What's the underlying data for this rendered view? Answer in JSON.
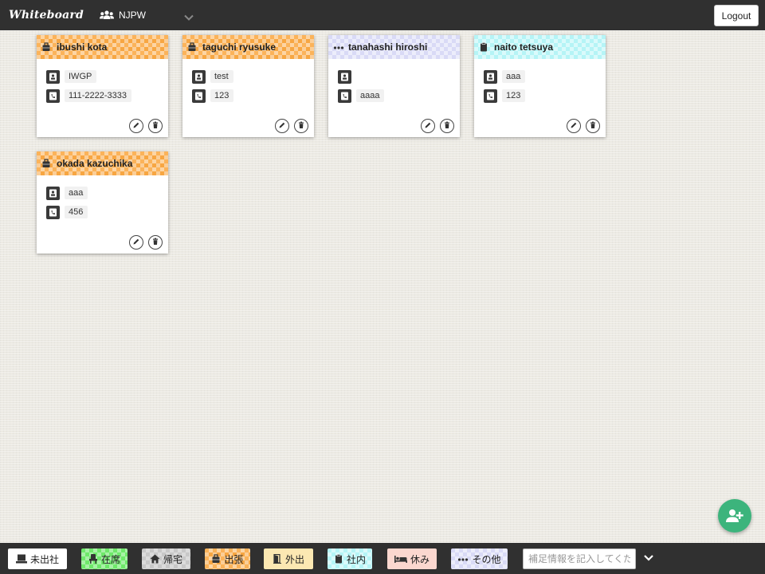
{
  "app": {
    "brand": "Whiteboard",
    "group": "NJPW",
    "logout_label": "Logout"
  },
  "cards": [
    {
      "name": "ibushi kota",
      "status": "出張",
      "status_icon": "suitcase-icon",
      "pattern": "orange",
      "field1": "IWGP",
      "field2": "111-2222-3333"
    },
    {
      "name": "taguchi ryusuke",
      "status": "出張",
      "status_icon": "suitcase-icon",
      "pattern": "orange",
      "field1": "test",
      "field2": "123"
    },
    {
      "name": "tanahashi hiroshi",
      "status": "その他",
      "status_icon": "ellipsis-icon",
      "pattern": "lavender",
      "field1": "",
      "field2": "aaaa"
    },
    {
      "name": "naito tetsuya",
      "status": "社内",
      "status_icon": "clipboard-icon",
      "pattern": "cyan",
      "field1": "aaa",
      "field2": "123"
    },
    {
      "name": "okada kazuchika",
      "status": "出張",
      "status_icon": "suitcase-icon",
      "pattern": "orange",
      "field1": "aaa",
      "field2": "456"
    }
  ],
  "statuses": [
    {
      "label": "未出社",
      "icon": "desk-icon",
      "color": "#ffffff"
    },
    {
      "label": "在席",
      "icon": "person-seat-icon",
      "color": "#6ee86a"
    },
    {
      "label": "帰宅",
      "icon": "home-icon",
      "color": "#c8c8c8"
    },
    {
      "label": "出張",
      "icon": "suitcase-icon",
      "color": "#fbb35a"
    },
    {
      "label": "外出",
      "icon": "door-icon",
      "color": "#fce8b2"
    },
    {
      "label": "社内",
      "icon": "clipboard-icon",
      "color": "#b5f4f6"
    },
    {
      "label": "休み",
      "icon": "bed-icon",
      "color": "#fbd7cf"
    },
    {
      "label": "その他",
      "icon": "ellipsis-icon",
      "color": "#d9daf6"
    }
  ],
  "memo": {
    "placeholder": "補足情報を記入してください"
  },
  "colors": {
    "bar": "#303030",
    "fab": "#3cb47c"
  }
}
